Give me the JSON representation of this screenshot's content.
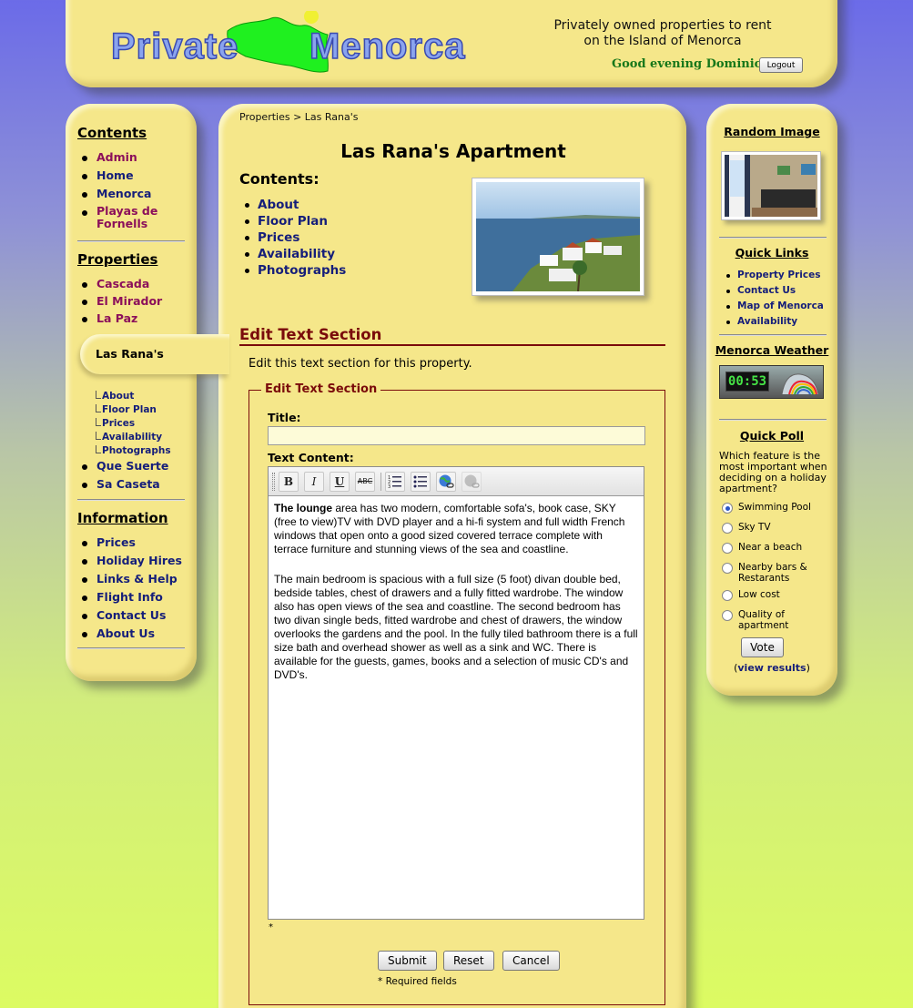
{
  "header": {
    "logo_text": "Private Menorca",
    "tagline_line1": "Privately owned properties to rent",
    "tagline_line2": "on the Island of Menorca",
    "greeting": "Good evening Dominic",
    "logout_label": "Logout"
  },
  "left_sidebar": {
    "contents": {
      "heading": "Contents",
      "items": [
        "Admin",
        "Home",
        "Menorca",
        "Playas de Fornells"
      ]
    },
    "properties": {
      "heading": "Properties",
      "items_before": [
        "Cascada",
        "El Mirador",
        "La Paz"
      ],
      "selected": "Las Rana's",
      "sub_items": [
        "About",
        "Floor Plan",
        "Prices",
        "Availability",
        "Photographs"
      ],
      "items_after": [
        "Que Suerte",
        "Sa Caseta"
      ]
    },
    "information": {
      "heading": "Information",
      "items": [
        "Prices",
        "Holiday Hires",
        "Links & Help",
        "Flight Info",
        "Contact Us",
        "About Us"
      ]
    }
  },
  "main": {
    "breadcrumb": "Properties > Las Rana's",
    "title": "Las Rana's Apartment",
    "contents_heading": "Contents:",
    "contents_items": [
      "About",
      "Floor Plan",
      "Prices",
      "Availability",
      "Photographs"
    ],
    "edit_heading": "Edit Text Section",
    "edit_description": "Edit this text section for this property.",
    "form": {
      "legend": "Edit Text Section",
      "title_label": "Title:",
      "title_value": "",
      "content_label": "Text Content:",
      "toolbar": {
        "bold": "B",
        "italic": "I",
        "underline": "U",
        "strike": "ABC"
      },
      "content_p1_bold": "The lounge",
      "content_p1": " area has two modern, comfortable sofa's, book case, SKY (free to view)TV with DVD player and a hi-fi system and full width French windows that open onto a good sized covered terrace complete with terrace furniture and stunning views of the sea and coastline.",
      "content_p2": "The main bedroom is spacious with a full size (5 foot) divan double bed, bedside tables, chest of drawers and a fully fitted wardrobe. The window also has open views of the sea and coastline. The second bedroom has two divan single beds, fitted wardrobe and chest of drawers, the window overlooks the gardens and the pool. In the fully tiled bathroom there is a full size bath and overhead shower as well as a sink and WC. There is available for the guests, games, books and a selection of music CD's and DVD's.",
      "required_star": "*",
      "submit_label": "Submit",
      "reset_label": "Reset",
      "cancel_label": "Cancel",
      "required_note": "* Required fields"
    }
  },
  "right_sidebar": {
    "random_image_heading": "Random Image",
    "quick_links_heading": "Quick Links",
    "quick_links": [
      "Property Prices",
      "Contact Us",
      "Map of Menorca",
      "Availability"
    ],
    "weather_heading": "Menorca Weather",
    "weather_time": "00:53",
    "poll_heading": "Quick Poll",
    "poll_question": "Which feature is the most important when deciding on a holiday apartment?",
    "poll_options": [
      "Swimming Pool",
      "Sky TV",
      "Near a beach",
      "Nearby bars & Restarants",
      "Low cost",
      "Quality of apartment"
    ],
    "poll_selected": "Swimming Pool",
    "vote_label": "Vote",
    "view_results_open": "(",
    "view_results_link": "view results",
    "view_results_close": ")"
  }
}
